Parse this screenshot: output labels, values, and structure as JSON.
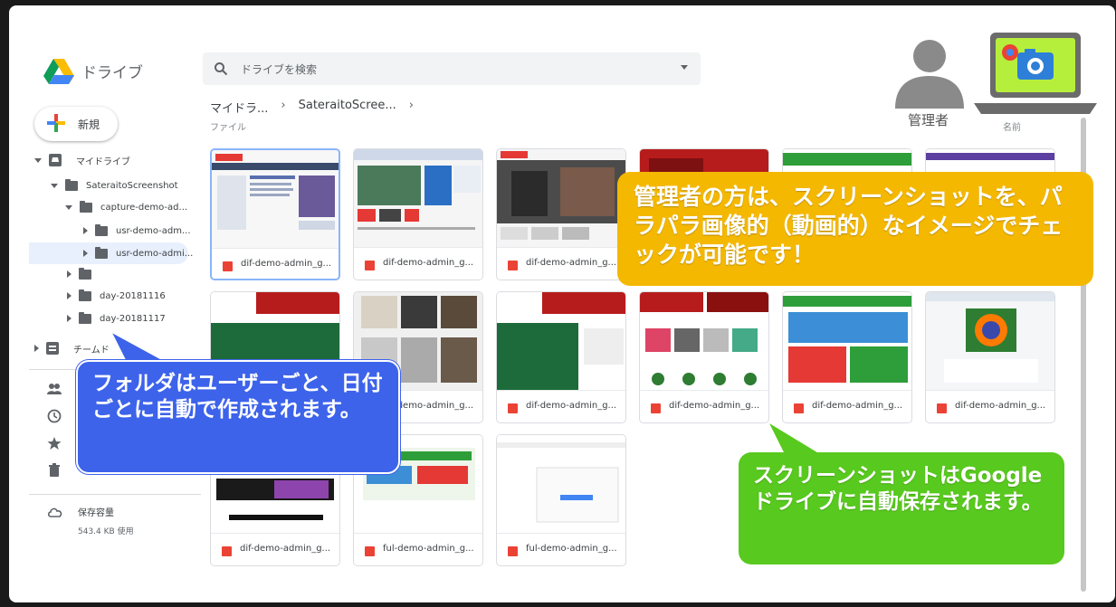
{
  "app": {
    "title": "ドライブ"
  },
  "search": {
    "placeholder": "ドライブを検索"
  },
  "breadcrumb": [
    "マイドラ...",
    "SateraitoScree..."
  ],
  "main": {
    "section_label": "ファイル",
    "sort_label": "名前"
  },
  "admin": {
    "label": "管理者"
  },
  "sidebar": {
    "new_label": "新規",
    "tree": [
      {
        "label": "マイドライブ"
      },
      {
        "label": "SateraitoScreenshot"
      },
      {
        "label": "capture-demo-ad..."
      },
      {
        "label": "usr-demo-adm..."
      },
      {
        "label": "usr-demo-admi..."
      },
      {
        "label": ""
      },
      {
        "label": "day-20181116"
      },
      {
        "label": "day-20181117"
      },
      {
        "label": "チームド"
      }
    ],
    "storage_label": "保存容量",
    "storage_used": "543.4 KB 使用"
  },
  "files": [
    {
      "name": "dif-demo-admin_g..."
    },
    {
      "name": "dif-demo-admin_g..."
    },
    {
      "name": "dif-demo-admin_g..."
    },
    {
      "name": ""
    },
    {
      "name": ""
    },
    {
      "name": ""
    },
    {
      "name": ""
    },
    {
      "name": ""
    },
    {
      "name": "dif-demo-admin_g..."
    },
    {
      "name": "dif-demo-admin_g..."
    },
    {
      "name": "dif-demo-admin_g..."
    },
    {
      "name": "dif-demo-admin_g..."
    },
    {
      "name": "dif-demo-admin_g..."
    },
    {
      "name": "ful-demo-admin_g..."
    },
    {
      "name": "ful-demo-admin_g..."
    }
  ],
  "callouts": {
    "yellow": "管理者の方は、スクリーンショットを、パラパラ画像的（動画的）なイメージでチェックが可能です！",
    "blue": "フォルダはユーザーごと、日付ごとに自動で作成されます。",
    "green": "スクリーンショットはGoogleドライブに自動保存されます。"
  },
  "colors": {
    "callout_yellow": "#f5b800",
    "callout_blue": "#3d63ea",
    "callout_green": "#58c91e",
    "selected": "#e8f0fe"
  }
}
